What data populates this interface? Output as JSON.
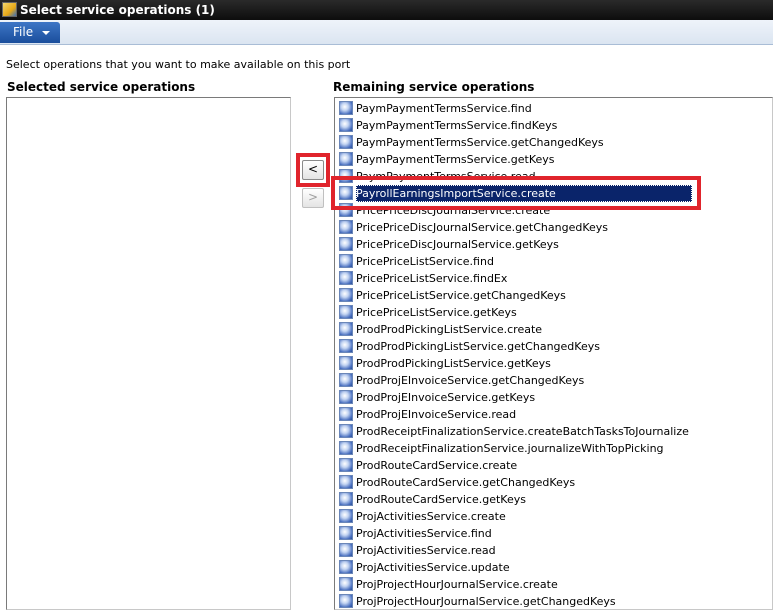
{
  "window": {
    "title": "Select service operations (1)"
  },
  "menu": {
    "file_label": "File"
  },
  "instruction": "Select operations that you want to make available on this port",
  "selected_panel": {
    "header": "Selected service operations",
    "items": []
  },
  "remaining_panel": {
    "header": "Remaining service operations",
    "items": [
      "PaymPaymentTermsService.find",
      "PaymPaymentTermsService.findKeys",
      "PaymPaymentTermsService.getChangedKeys",
      "PaymPaymentTermsService.getKeys",
      "PaymPaymentTermsService.read",
      "PayrollEarningsImportService.create",
      "PricePriceDiscJournalService.create",
      "PricePriceDiscJournalService.getChangedKeys",
      "PricePriceDiscJournalService.getKeys",
      "PricePriceListService.find",
      "PricePriceListService.findEx",
      "PricePriceListService.getChangedKeys",
      "PricePriceListService.getKeys",
      "ProdProdPickingListService.create",
      "ProdProdPickingListService.getChangedKeys",
      "ProdProdPickingListService.getKeys",
      "ProdProjEInvoiceService.getChangedKeys",
      "ProdProjEInvoiceService.getKeys",
      "ProdProjEInvoiceService.read",
      "ProdReceiptFinalizationService.createBatchTasksToJournalize",
      "ProdReceiptFinalizationService.journalizeWithTopPicking",
      "ProdRouteCardService.create",
      "ProdRouteCardService.getChangedKeys",
      "ProdRouteCardService.getKeys",
      "ProjActivitiesService.create",
      "ProjActivitiesService.find",
      "ProjActivitiesService.read",
      "ProjActivitiesService.update",
      "ProjProjectHourJournalService.create",
      "ProjProjectHourJournalService.getChangedKeys"
    ],
    "selected_item": "PayrollEarningsImportService.create"
  },
  "buttons": {
    "add_label": "<",
    "remove_label": ">"
  },
  "colors": {
    "highlight": "#e0242c",
    "selection": "#0a246a",
    "file_menu": "#2a5fb0"
  },
  "icons": {
    "item_icon": "service-operation-icon",
    "app_icon": "app-icon"
  }
}
